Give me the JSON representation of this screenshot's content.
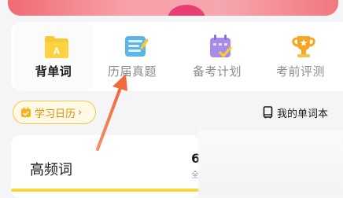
{
  "tabs": [
    {
      "label": "背单词",
      "icon": "folder-a-icon",
      "active": true
    },
    {
      "label": "历届真题",
      "icon": "exam-paper-icon",
      "active": false
    },
    {
      "label": "备考计划",
      "icon": "calendar-check-icon",
      "active": false
    },
    {
      "label": "考前评测",
      "icon": "trophy-icon",
      "active": false
    }
  ],
  "study_calendar": {
    "label": "学习日历",
    "chevron": "›"
  },
  "word_book": {
    "label": "我的单词本"
  },
  "card": {
    "title": "高频词",
    "count": "6",
    "sub": "全"
  },
  "colors": {
    "accent_yellow": "#f7c531",
    "calendar_text": "#d88e00",
    "annotation_arrow": "#f07a4a"
  }
}
